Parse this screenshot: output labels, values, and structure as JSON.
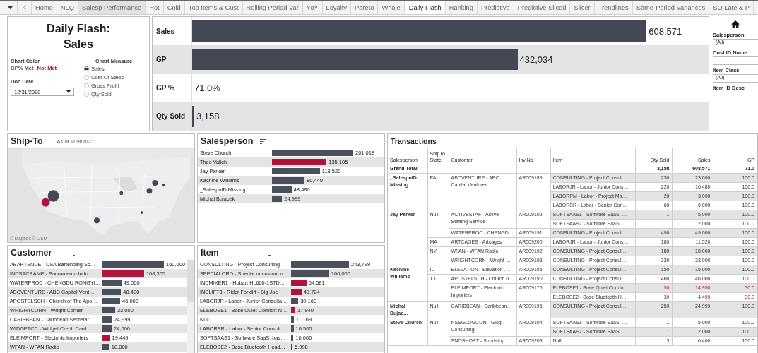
{
  "tabs": [
    {
      "label": "Home",
      "selected": false,
      "highlighted": false
    },
    {
      "label": "NLQ",
      "selected": false,
      "highlighted": false
    },
    {
      "label": "Salesp Performance",
      "selected": false,
      "highlighted": true
    },
    {
      "label": "Hot",
      "selected": false,
      "highlighted": false
    },
    {
      "label": "Cold",
      "selected": false,
      "highlighted": false
    },
    {
      "label": "Top Items & Cust",
      "selected": false,
      "highlighted": false
    },
    {
      "label": "Rolling Period Var",
      "selected": false,
      "highlighted": false
    },
    {
      "label": "YoY",
      "selected": false,
      "highlighted": false
    },
    {
      "label": "Loyalty",
      "selected": false,
      "highlighted": false
    },
    {
      "label": "Pareto",
      "selected": false,
      "highlighted": false
    },
    {
      "label": "Whale",
      "selected": false,
      "highlighted": false
    },
    {
      "label": "Daily Flash",
      "selected": true,
      "highlighted": false
    },
    {
      "label": "Ranking",
      "selected": false,
      "highlighted": false
    },
    {
      "label": "Predictive",
      "selected": false,
      "highlighted": false
    },
    {
      "label": "Predictive Sliced",
      "selected": false,
      "highlighted": false
    },
    {
      "label": "Slicer",
      "selected": false,
      "highlighted": false
    },
    {
      "label": "Trendlines",
      "selected": false,
      "highlighted": false
    },
    {
      "label": "Same-Period Variances",
      "selected": false,
      "highlighted": false
    },
    {
      "label": "SO Late & P",
      "selected": false,
      "highlighted": false
    }
  ],
  "header": {
    "title": "Daily Flash: Sales",
    "chart_color": {
      "label": "Chart Color",
      "items": [
        {
          "label": "GP% Met",
          "color": "#4a4f5c"
        },
        {
          "label": "Not Met",
          "color": "#b0143a"
        }
      ],
      "separator": ","
    },
    "chart_measure": {
      "label": "Chart Measure",
      "options": [
        {
          "label": "Sales",
          "selected": true
        },
        {
          "label": "Cost Of Sales",
          "selected": false
        },
        {
          "label": "Gross Profit",
          "selected": false
        },
        {
          "label": "Qty Sold",
          "selected": false
        }
      ]
    },
    "doc_date": {
      "label": "Doc Date",
      "value": "12/31/2020"
    }
  },
  "kpis": [
    {
      "label": "Sales",
      "kind": "bar",
      "level": 0.88,
      "value": "608,571"
    },
    {
      "label": "GP",
      "kind": "bar",
      "level": 0.63,
      "value": "432,034"
    },
    {
      "label": "GP %",
      "kind": "text",
      "value": "71.0%"
    },
    {
      "label": "Qty Sold",
      "kind": "bar",
      "level": 0.004,
      "value": "3,158"
    }
  ],
  "filters": [
    {
      "label": "Salesperson",
      "kind": "dropdown",
      "value": "(All)"
    },
    {
      "label": "Cust ID Name",
      "kind": "field"
    },
    {
      "label": "Item Class",
      "kind": "dropdown",
      "value": "(All)"
    },
    {
      "label": "Item ID Desc",
      "kind": "field"
    }
  ],
  "ship_to": {
    "title": "Ship-To",
    "subtitle": "As of 1/28/2021",
    "credit": "© Mapbox © OSM"
  },
  "salesperson": {
    "title": "Salesperson",
    "bars": [
      {
        "label": "Steve Church",
        "value": "201,018",
        "not_met": false
      },
      {
        "label": "Theo Valich",
        "value": "135,105",
        "not_met": true
      },
      {
        "label": "Jay Parker",
        "value": "118,520",
        "not_met": false
      },
      {
        "label": "Kachine Williams",
        "value": "80,449",
        "not_met": false
      },
      {
        "label": "_SalespnID Missing",
        "value": "48,480",
        "not_met": false
      },
      {
        "label": "Michal Bujacek",
        "value": "24,999",
        "not_met": false
      }
    ]
  },
  "transactions": {
    "title": "Transactions",
    "columns": [
      "Salesperson",
      "ShipTo State",
      "Customer",
      "Inv No",
      "Item",
      "Qty Sold",
      "Sales",
      "GP"
    ],
    "total": {
      "label": "Grand Total",
      "qty": "3,158",
      "sales": "608,571",
      "gp": "71.0"
    },
    "rows": [
      {
        "salesperson": "_SalespnID Missing",
        "state": "PA",
        "customer": "ABCVENTURE - ABC Capital Ventures",
        "inv_no": "AR009189",
        "item": "CONSULTING - Project Consul…",
        "qty": "230",
        "sales": "23,000",
        "gp": "100.0",
        "not_met": false
      },
      {
        "item": "LABORJR - Labor - Junior Cons…",
        "qty": "220",
        "sales": "16,480",
        "gp": "100.0",
        "not_met": false
      },
      {
        "item": "LABORPM - Labor - Project Ma…",
        "qty": "20",
        "sales": "3,000",
        "gp": "100.0",
        "not_met": false
      },
      {
        "item": "LABORSR - Labor - Senior Con…",
        "qty": "60",
        "sales": "6,000",
        "gp": "100.0",
        "not_met": false
      },
      {
        "salesperson": "Jay Parker",
        "state": "Null",
        "customer": "ACTIVESTAF - Active Staffing Service",
        "inv_no": "AR009102",
        "item": "SOFTSAAS1 - Software SaaS, …",
        "qty": "1",
        "sales": "5,000",
        "gp": "100.0",
        "not_met": false
      },
      {
        "item": "SOFTSAAS2 - Software SaaS, …",
        "qty": "1",
        "sales": "2,000",
        "gp": "100.0",
        "not_met": false
      },
      {
        "customer": "WATERPROC - CHENGD…",
        "inv_no": "AR009191",
        "item": "CONSULTING - Project Consul…",
        "qty": "490",
        "sales": "49,000",
        "gp": "100.0",
        "not_met": false
      },
      {
        "state": "MA",
        "customer": "ARTCAGES - Artcages",
        "inv_no": "AR009200",
        "item": "LABORJR - Labor - Junior Cons…",
        "qty": "180",
        "sales": "11,520",
        "gp": "100.0",
        "not_met": false
      },
      {
        "state": "NY",
        "customer": "WFAN - WFAN Radio",
        "inv_no": "AR009192",
        "item": "CONSULTING - Project Consul…",
        "qty": "180",
        "sales": "18,000",
        "gp": "100.0",
        "not_met": false
      },
      {
        "customer": "WRIGHTCORN - Wright …",
        "inv_no": "AR009193",
        "item": "CONSULTING - Project Consul…",
        "qty": "330",
        "sales": "33,000",
        "gp": "100.0",
        "not_met": false
      },
      {
        "salesperson": "Kachine Williams",
        "state": "IL",
        "customer": "ELEVATION - Elevation …",
        "inv_no": "AR009195",
        "item": "CONSULTING - Project Consul…",
        "qty": "150",
        "sales": "15,000",
        "gp": "100.0",
        "not_met": false
      },
      {
        "state": "TX",
        "customer": "APOSTELSCH - Church o…",
        "inv_no": "AR009190",
        "item": "CONSULTING - Project Consul…",
        "qty": "460",
        "sales": "46,000",
        "gp": "100.0",
        "not_met": false
      },
      {
        "customer": "ELEIMPORT - Electonic Importers",
        "inv_no": "AR009175",
        "item": "ELEBOSE1 - Bose Quiet Comfo…",
        "qty": "50",
        "sales": "14,950",
        "gp": "30.0",
        "not_met": true
      },
      {
        "item": "ELEBOSE2 - Bose Bluetooth H…",
        "qty": "30",
        "sales": "4,499",
        "gp": "30.0",
        "not_met": true
      },
      {
        "salesperson": "Michal Bujac…",
        "state": "Null",
        "customer": "CARIBBEAN - Caribbean…",
        "inv_no": "AR009196",
        "item": "CONSULTING - Project Consul…",
        "qty": "250",
        "sales": "24,999",
        "gp": "100.0",
        "not_met": false
      },
      {
        "salesperson": "Steve Church",
        "state": "Null",
        "customer": "NSSGLOGCON - Glog Consulting",
        "inv_no": "AR009104",
        "item": "SOFTSAAS1 - Software SaaS, …",
        "qty": "1",
        "sales": "5,000",
        "gp": "100.0",
        "not_met": false
      },
      {
        "item": "SOFTSAAS2 - Software SaaS, …",
        "qty": "1",
        "sales": "2,000",
        "gp": "100.0",
        "not_met": false
      },
      {
        "customer": "SNOSHORT - Shortstop …",
        "inv_no": "AR009203",
        "item": "Null",
        "qty": "3",
        "sales": "6,400",
        "gp": "100.0",
        "not_met": false
      }
    ]
  },
  "customer": {
    "title": "Customer",
    "bars": [
      {
        "label": "ABARTENDE - USA Bartending Sc…",
        "value": "160,000",
        "not_met": false
      },
      {
        "label": "INDSACRAME - Sacramento Indu…",
        "value": "108,305",
        "not_met": true
      },
      {
        "label": "WATERPROC - CHENGDU RONGYI…",
        "value": "49,000",
        "not_met": false
      },
      {
        "label": "ABCVENTURE - ABC Capital Vent…",
        "value": "48,480",
        "not_met": false
      },
      {
        "label": "APOSTELSCH - Church of The Apo…",
        "value": "46,000",
        "not_met": false
      },
      {
        "label": "WRIGHTCORN - Wright Corner",
        "value": "33,000",
        "not_met": false
      },
      {
        "label": "CARIBBEAN - Caribbean Secretar…",
        "value": "24,999",
        "not_met": false
      },
      {
        "label": "WIDGETCC - Widget Credit Card",
        "value": "24,000",
        "not_met": false
      },
      {
        "label": "ELEIMPORT - Electonic Importers",
        "value": "19,449",
        "not_met": true
      },
      {
        "label": "WFAN - WFAN Radio",
        "value": "18,000",
        "not_met": false
      }
    ]
  },
  "item": {
    "title": "Item",
    "bars": [
      {
        "label": "CONSULTING - Project Consulting",
        "value": "243,799",
        "not_met": false
      },
      {
        "label": "SPECIALORD - Special or custom o…",
        "value": "160,000",
        "not_met": false
      },
      {
        "label": "INDMIXER1 - Hobart HL600-1STD…",
        "value": "64,581",
        "not_met": true
      },
      {
        "label": "INDLIFT3 - Rider Forklift - Big Joe",
        "value": "43,724",
        "not_met": true
      },
      {
        "label": "LABORJR - Labor - Junior Consulta…",
        "value": "30,160",
        "not_met": false
      },
      {
        "label": "ELEBOSE1 - Bose Quiet Comfort N…",
        "value": "17,940",
        "not_met": true
      },
      {
        "label": "Null",
        "value": "11,169",
        "not_met": false
      },
      {
        "label": "LABORSR - Labor - Senior Consult…",
        "value": "10,500",
        "not_met": false
      },
      {
        "label": "SOFTSAAS1 - Software SaaS, bas…",
        "value": "10,000",
        "not_met": false
      },
      {
        "label": "ELEBOSE2 - Bose Bluetooth Head…",
        "value": "5,998",
        "not_met": true
      }
    ]
  }
}
